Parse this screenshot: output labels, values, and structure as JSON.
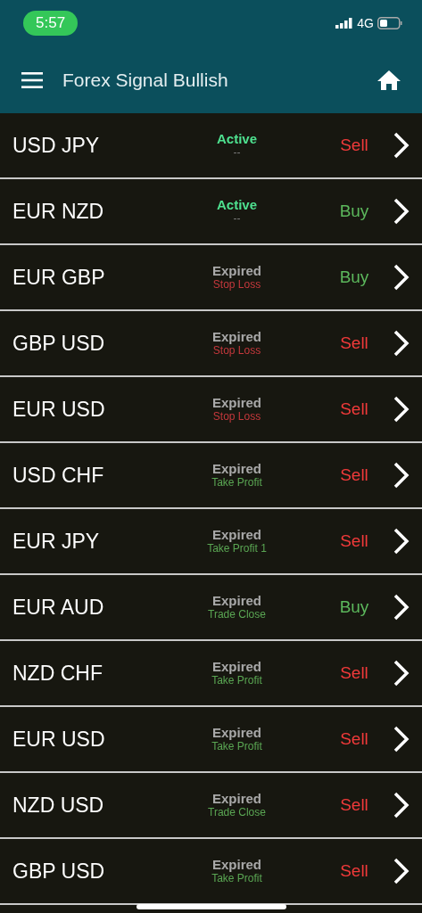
{
  "status_bar": {
    "time": "5:57",
    "network": "4G"
  },
  "app_bar": {
    "title": "Forex Signal Bullish"
  },
  "signals": [
    {
      "pair": "USD JPY",
      "status": {
        "text": "Active",
        "color": "#4ee08f"
      },
      "result": {
        "text": "--",
        "color": "#7b7b7b"
      },
      "action": {
        "text": "Sell",
        "color": "#f23a3a"
      }
    },
    {
      "pair": "EUR NZD",
      "status": {
        "text": "Active",
        "color": "#4ee08f"
      },
      "result": {
        "text": "--",
        "color": "#7b7b7b"
      },
      "action": {
        "text": "Buy",
        "color": "#5cb85c"
      }
    },
    {
      "pair": "EUR GBP",
      "status": {
        "text": "Expired",
        "color": "#a9a9a9"
      },
      "result": {
        "text": "Stop Loss",
        "color": "#c5383c"
      },
      "action": {
        "text": "Buy",
        "color": "#5cb85c"
      }
    },
    {
      "pair": "GBP USD",
      "status": {
        "text": "Expired",
        "color": "#a9a9a9"
      },
      "result": {
        "text": "Stop Loss",
        "color": "#c5383c"
      },
      "action": {
        "text": "Sell",
        "color": "#f23a3a"
      }
    },
    {
      "pair": "EUR USD",
      "status": {
        "text": "Expired",
        "color": "#a9a9a9"
      },
      "result": {
        "text": "Stop Loss",
        "color": "#c5383c"
      },
      "action": {
        "text": "Sell",
        "color": "#f23a3a"
      }
    },
    {
      "pair": "USD CHF",
      "status": {
        "text": "Expired",
        "color": "#a9a9a9"
      },
      "result": {
        "text": "Take Profit",
        "color": "#5aa653"
      },
      "action": {
        "text": "Sell",
        "color": "#f23a3a"
      }
    },
    {
      "pair": "EUR JPY",
      "status": {
        "text": "Expired",
        "color": "#a9a9a9"
      },
      "result": {
        "text": "Take Profit 1",
        "color": "#5aa653"
      },
      "action": {
        "text": "Sell",
        "color": "#f23a3a"
      }
    },
    {
      "pair": "EUR AUD",
      "status": {
        "text": "Expired",
        "color": "#a9a9a9"
      },
      "result": {
        "text": "Trade Close",
        "color": "#5aa653"
      },
      "action": {
        "text": "Buy",
        "color": "#5cb85c"
      }
    },
    {
      "pair": "NZD CHF",
      "status": {
        "text": "Expired",
        "color": "#a9a9a9"
      },
      "result": {
        "text": "Take Profit",
        "color": "#5aa653"
      },
      "action": {
        "text": "Sell",
        "color": "#f23a3a"
      }
    },
    {
      "pair": "EUR USD",
      "status": {
        "text": "Expired",
        "color": "#a9a9a9"
      },
      "result": {
        "text": "Take Profit",
        "color": "#5aa653"
      },
      "action": {
        "text": "Sell",
        "color": "#f23a3a"
      }
    },
    {
      "pair": "NZD USD",
      "status": {
        "text": "Expired",
        "color": "#a9a9a9"
      },
      "result": {
        "text": "Trade Close",
        "color": "#5aa653"
      },
      "action": {
        "text": "Sell",
        "color": "#f23a3a"
      }
    },
    {
      "pair": "GBP USD",
      "status": {
        "text": "Expired",
        "color": "#a9a9a9"
      },
      "result": {
        "text": "Take Profit",
        "color": "#5aa653"
      },
      "action": {
        "text": "Sell",
        "color": "#f23a3a"
      }
    }
  ]
}
